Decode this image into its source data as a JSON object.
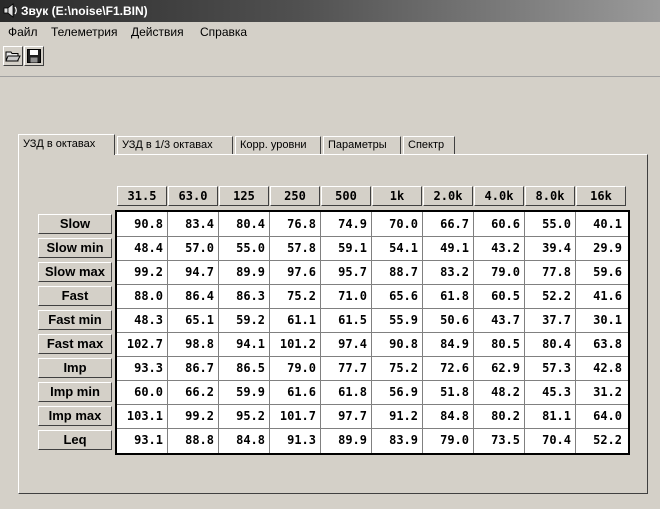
{
  "window": {
    "title": "Звук (E:\\noise\\F1.BIN)"
  },
  "menu": [
    "Файл",
    "Телеметрия",
    "Действия",
    "Справка"
  ],
  "toolbar": {
    "buttons": [
      {
        "icon": "open-folder-icon"
      },
      {
        "icon": "save-disk-icon"
      }
    ]
  },
  "tabs": [
    {
      "label": "УЗД в октавах",
      "active": true
    },
    {
      "label": "УЗД в 1/3 октавах",
      "active": false
    },
    {
      "label": "Корр. уровни",
      "active": false
    },
    {
      "label": "Параметры",
      "active": false
    },
    {
      "label": "Спектр",
      "active": false
    }
  ],
  "table": {
    "columns": [
      "31.5",
      "63.0",
      "125",
      "250",
      "500",
      "1k",
      "2.0k",
      "4.0k",
      "8.0k",
      "16k"
    ],
    "rows": [
      {
        "label": "Slow",
        "values": [
          "90.8",
          "83.4",
          "80.4",
          "76.8",
          "74.9",
          "70.0",
          "66.7",
          "60.6",
          "55.0",
          "40.1"
        ]
      },
      {
        "label": "Slow min",
        "values": [
          "48.4",
          "57.0",
          "55.0",
          "57.8",
          "59.1",
          "54.1",
          "49.1",
          "43.2",
          "39.4",
          "29.9"
        ]
      },
      {
        "label": "Slow max",
        "values": [
          "99.2",
          "94.7",
          "89.9",
          "97.6",
          "95.7",
          "88.7",
          "83.2",
          "79.0",
          "77.8",
          "59.6"
        ]
      },
      {
        "label": "Fast",
        "values": [
          "88.0",
          "86.4",
          "86.3",
          "75.2",
          "71.0",
          "65.6",
          "61.8",
          "60.5",
          "52.2",
          "41.6"
        ]
      },
      {
        "label": "Fast min",
        "values": [
          "48.3",
          "65.1",
          "59.2",
          "61.1",
          "61.5",
          "55.9",
          "50.6",
          "43.7",
          "37.7",
          "30.1"
        ]
      },
      {
        "label": "Fast max",
        "values": [
          "102.7",
          "98.8",
          "94.1",
          "101.2",
          "97.4",
          "90.8",
          "84.9",
          "80.5",
          "80.4",
          "63.8"
        ]
      },
      {
        "label": "Imp",
        "values": [
          "93.3",
          "86.7",
          "86.5",
          "79.0",
          "77.7",
          "75.2",
          "72.6",
          "62.9",
          "57.3",
          "42.8"
        ]
      },
      {
        "label": "Imp min",
        "values": [
          "60.0",
          "66.2",
          "59.9",
          "61.6",
          "61.8",
          "56.9",
          "51.8",
          "48.2",
          "45.3",
          "31.2"
        ]
      },
      {
        "label": "Imp max",
        "values": [
          "103.1",
          "99.2",
          "95.2",
          "101.7",
          "97.7",
          "91.2",
          "84.8",
          "80.2",
          "81.1",
          "64.0"
        ]
      },
      {
        "label": "Leq",
        "values": [
          "93.1",
          "88.8",
          "84.8",
          "91.3",
          "89.9",
          "83.9",
          "79.0",
          "73.5",
          "70.4",
          "52.2"
        ]
      }
    ]
  }
}
